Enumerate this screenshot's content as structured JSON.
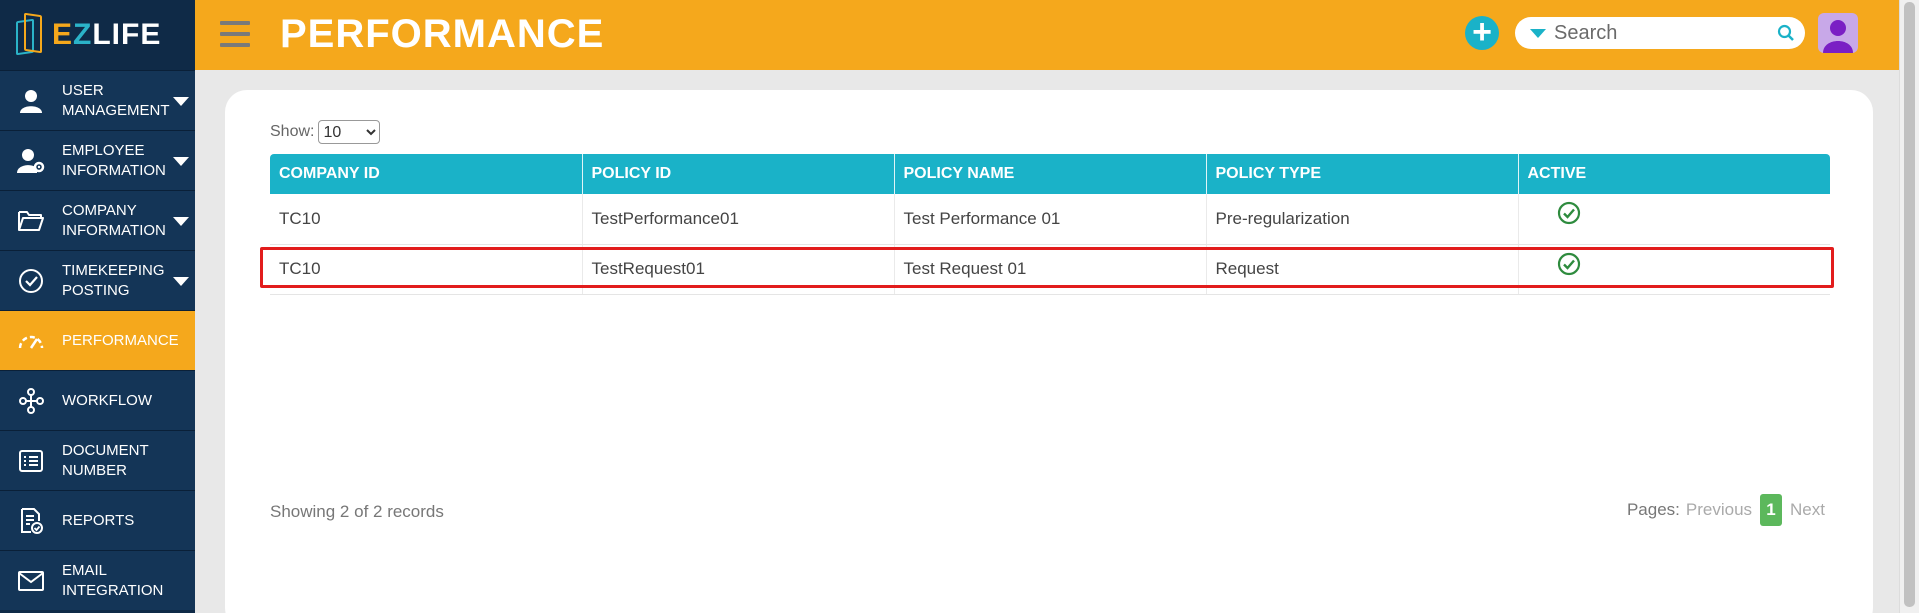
{
  "app": {
    "logo_text_e": "E",
    "logo_text_z": "Z",
    "logo_text_rest": "LIFE"
  },
  "sidebar": {
    "items": [
      {
        "label": "USER MANAGEMENT",
        "icon": "user-icon",
        "has_caret": true,
        "active": false
      },
      {
        "label": "EMPLOYEE INFORMATION",
        "icon": "user-gear-icon",
        "has_caret": true,
        "active": false
      },
      {
        "label": "COMPANY INFORMATION",
        "icon": "folder-icon",
        "has_caret": true,
        "active": false
      },
      {
        "label": "TIMEKEEPING POSTING",
        "icon": "check-circle-icon",
        "has_caret": true,
        "active": false
      },
      {
        "label": "PERFORMANCE",
        "icon": "gauge-icon",
        "has_caret": false,
        "active": true
      },
      {
        "label": "WORKFLOW",
        "icon": "workflow-icon",
        "has_caret": false,
        "active": false
      },
      {
        "label": "DOCUMENT NUMBER",
        "icon": "list-icon",
        "has_caret": false,
        "active": false
      },
      {
        "label": "REPORTS",
        "icon": "report-icon",
        "has_caret": false,
        "active": false
      },
      {
        "label": "EMAIL INTEGRATION",
        "icon": "mail-icon",
        "has_caret": false,
        "active": false
      }
    ]
  },
  "header": {
    "title": "PERFORMANCE",
    "add_label": "+",
    "search_placeholder": "Search"
  },
  "main": {
    "show_label": "Show:",
    "page_size": "10",
    "page_size_options": [
      "10"
    ],
    "columns": [
      "COMPANY ID",
      "POLICY ID",
      "POLICY NAME",
      "POLICY TYPE",
      "ACTIVE"
    ],
    "rows": [
      {
        "company_id": "TC10",
        "policy_id": "TestPerformance01",
        "policy_name": "Test Performance 01",
        "policy_type": "Pre-regularization",
        "active": true
      },
      {
        "company_id": "TC10",
        "policy_id": "TestRequest01",
        "policy_name": "Test Request 01",
        "policy_type": "Request",
        "active": true
      }
    ],
    "showing_text": "Showing 2 of 2 records",
    "pager": {
      "label": "Pages:",
      "prev": "Previous",
      "current": "1",
      "next": "Next"
    }
  },
  "colors": {
    "accent_orange": "#f5a81c",
    "sidebar_navy": "#0f2a47",
    "table_header_teal": "#1ab2c8",
    "active_check_green": "#2e8b3e",
    "highlight_red": "#e21c1c"
  }
}
